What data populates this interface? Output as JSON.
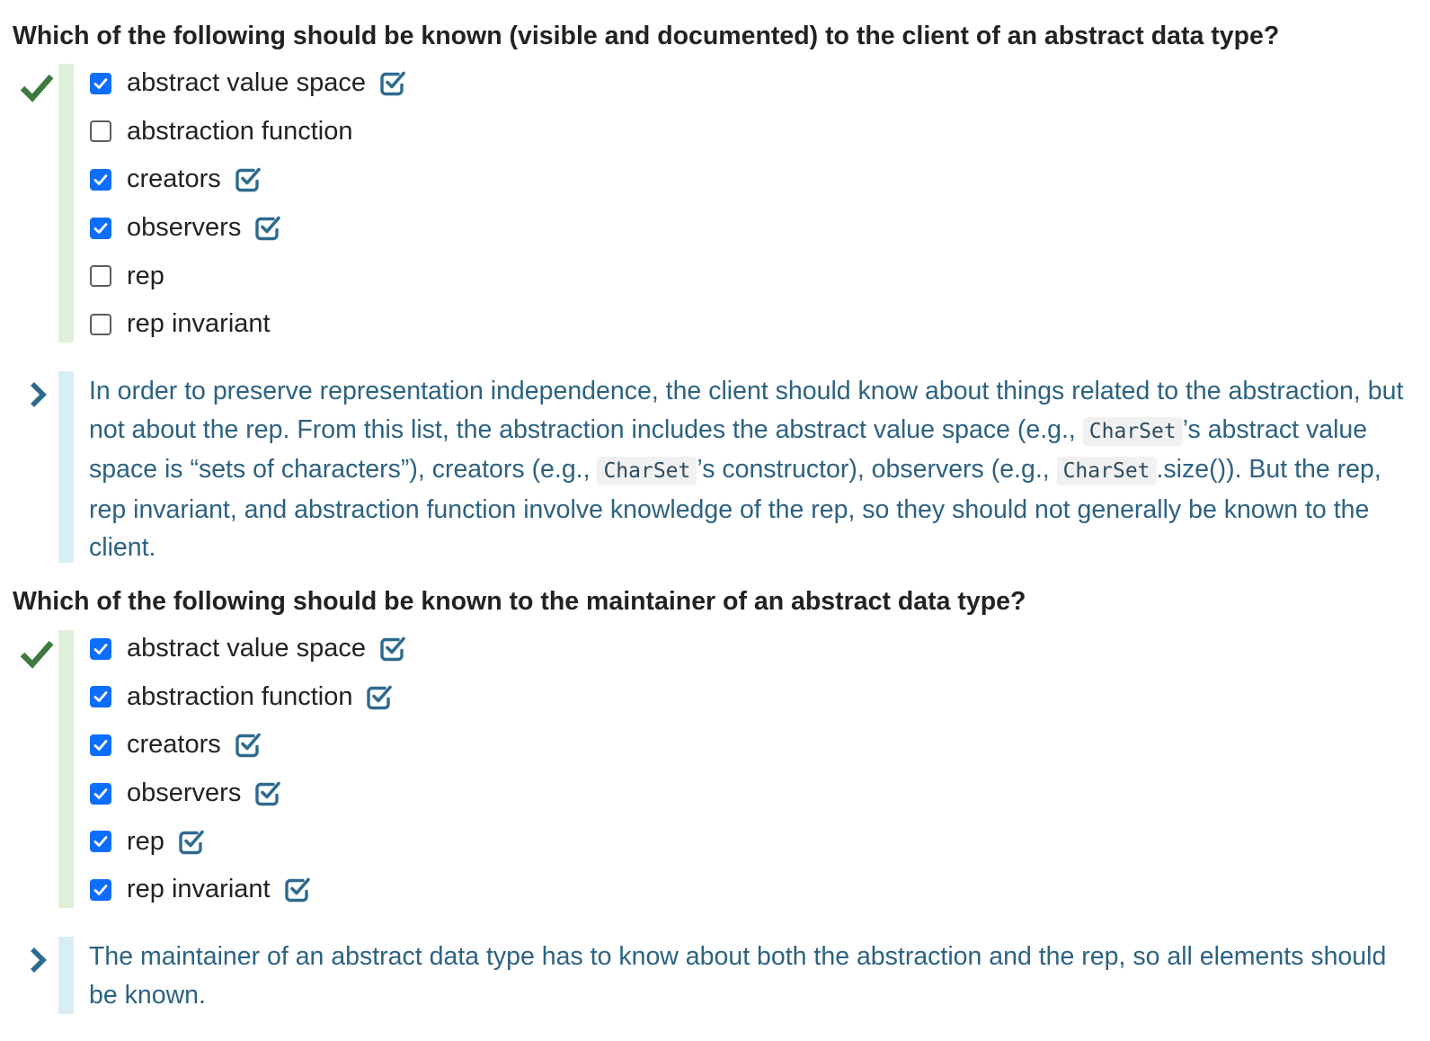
{
  "question1": {
    "title": "Which of the following should be known (visible and documented) to the client of an abstract data type?",
    "options": [
      {
        "label": "abstract value space",
        "checked": true,
        "correct_icon": "check-square-icon"
      },
      {
        "label": "abstraction function",
        "checked": false
      },
      {
        "label": "creators",
        "checked": true,
        "correct_icon": "check-square-icon"
      },
      {
        "label": "observers",
        "checked": true,
        "correct_icon": "check-square-icon"
      },
      {
        "label": "rep",
        "checked": false
      },
      {
        "label": "rep invariant",
        "checked": false
      }
    ],
    "explanation": {
      "part1": "In order to preserve representation independence, the client should know about things related to the abstraction, but not about the rep. From this list, the abstraction includes the abstract value space (e.g., ",
      "code1": "CharSet",
      "part2": "’s abstract value space is “sets of characters”), creators (e.g., ",
      "code2": "CharSet",
      "part3": "’s constructor), observers (e.g., ",
      "code3": "CharSet",
      "part4": ".size()). But the rep, rep invariant, and abstraction function involve knowledge of the rep, so they should not generally be known to the client."
    }
  },
  "question2": {
    "title": "Which of the following should be known to the maintainer of an abstract data type?",
    "options": [
      {
        "label": "abstract value space",
        "checked": true,
        "correct_icon": "check-square-icon"
      },
      {
        "label": "abstraction function",
        "checked": true,
        "correct_icon": "check-square-icon"
      },
      {
        "label": "creators",
        "checked": true,
        "correct_icon": "check-square-icon"
      },
      {
        "label": "observers",
        "checked": true,
        "correct_icon": "check-square-icon"
      },
      {
        "label": "rep",
        "checked": true,
        "correct_icon": "check-square-icon"
      },
      {
        "label": "rep invariant",
        "checked": true,
        "correct_icon": "check-square-icon"
      }
    ],
    "explanation": {
      "text": "The maintainer of an abstract data type has to know about both the abstraction and the rep, so all elements should be known."
    }
  },
  "icons": {
    "correct_mark": "checkmark-icon",
    "explanation_toggle": "chevron-right-icon"
  },
  "colors": {
    "correct_green": "#3e7a3e",
    "answer_bar": "#dff0d8",
    "explanation_bar": "#d9edf7",
    "explanation_text": "#2c6282",
    "checkbox_checked": "#0d6efd",
    "correct_icon": "#2e6a8e",
    "chevron": "#2e6a8e"
  }
}
